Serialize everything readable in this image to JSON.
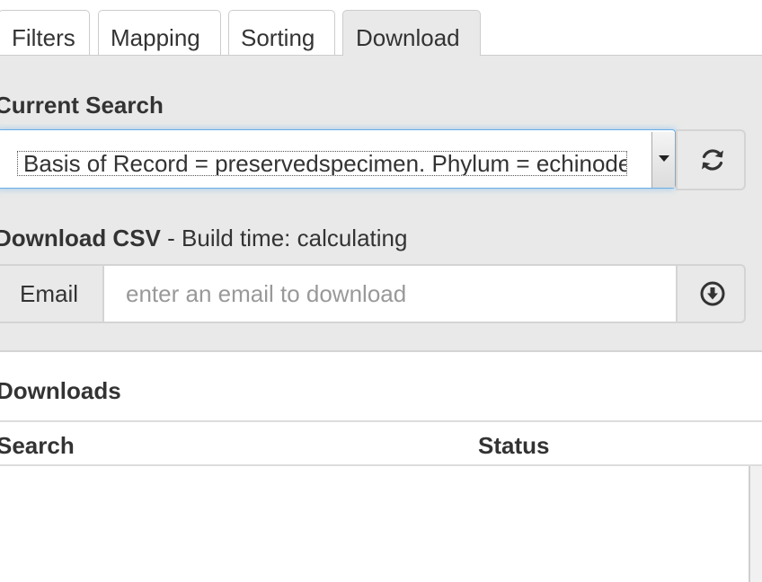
{
  "tabs": [
    {
      "label": "Filters",
      "active": false
    },
    {
      "label": "Mapping",
      "active": false
    },
    {
      "label": "Sorting",
      "active": false
    },
    {
      "label": "Download",
      "active": true
    }
  ],
  "current_search": {
    "title": "Current Search",
    "selected_value": "Basis of Record = preservedspecimen. Phylum = echinodermata",
    "refresh_icon": "refresh-icon"
  },
  "download_csv": {
    "title": "Download CSV",
    "build_time_text": " - Build time: calculating",
    "email_label": "Email",
    "email_placeholder": "enter an email to download",
    "email_value": "",
    "download_icon": "download-circle-icon"
  },
  "downloads": {
    "title": "Downloads",
    "columns": [
      "Search",
      "Status"
    ],
    "rows": []
  },
  "colors": {
    "panel_background": "#e9e9e9",
    "focus_border": "#66afe9",
    "border": "#d4d4d4",
    "text": "#333333",
    "placeholder": "#999999"
  }
}
